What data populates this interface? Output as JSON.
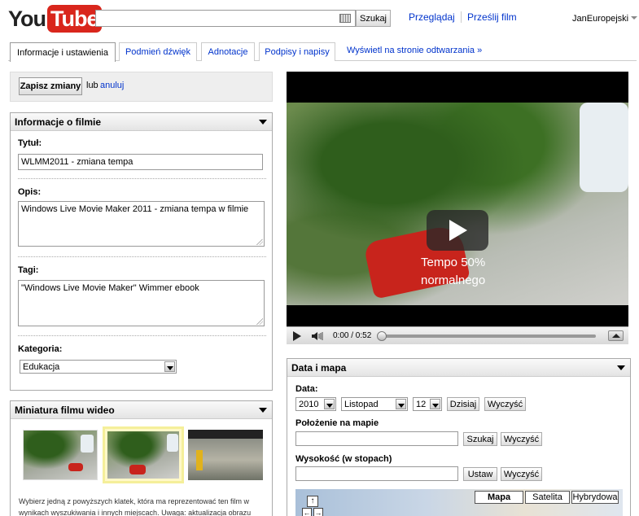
{
  "header": {
    "logo_you": "You",
    "logo_tube": "Tube",
    "search_value": "",
    "search_button": "Szukaj",
    "nav_browse": "Przeglądaj",
    "nav_upload": "Prześlij film",
    "username": "JanEuropejski"
  },
  "tabs": [
    {
      "label": "Informacje i ustawienia",
      "active": true
    },
    {
      "label": "Podmień dźwięk"
    },
    {
      "label": "Adnotacje"
    },
    {
      "label": "Podpisy i napisy"
    }
  ],
  "watch_link": "Wyświetl na stronie odtwarzania »",
  "savebar": {
    "save_label": "Zapisz zmiany",
    "or_text": "lub",
    "cancel_label": "anuluj"
  },
  "info_panel": {
    "title": "Informacje o filmie",
    "title_label": "Tytuł:",
    "title_value": "WLMM2011 - zmiana tempa",
    "description_label": "Opis:",
    "description_value": "Windows Live Movie Maker 2011 - zmiana tempa w filmie",
    "tags_label": "Tagi:",
    "tags_value": "\"Windows Live Movie Maker\" Wimmer ebook",
    "category_label": "Kategoria:",
    "category_value": "Edukacja"
  },
  "thumb_panel": {
    "title": "Miniatura filmu wideo",
    "selected_index": 1,
    "text": "Wybierz jedną z powyższych klatek, która ma reprezentować ten film w wynikach wyszukiwania i innych miejscach. Uwaga: aktualizacja obrazu"
  },
  "video": {
    "overlay_line1": "Tempo 50%",
    "overlay_line2": "normalnego",
    "time": "0:00 / 0:52",
    "progress": 0
  },
  "map_panel": {
    "title": "Data i mapa",
    "date_label": "Data:",
    "year": "2010",
    "month": "Listopad",
    "day": "12",
    "today_button": "Dzisiaj",
    "clear_button": "Wyczyść",
    "location_label": "Położenie na mapie",
    "location_value": "",
    "search_button": "Szukaj",
    "location_clear": "Wyczyść",
    "altitude_label": "Wysokość (w stopach)",
    "altitude_value": "",
    "set_button": "Ustaw",
    "altitude_clear": "Wyczyść",
    "map_types": [
      "Mapa",
      "Satelita",
      "Hybrydowa"
    ]
  }
}
